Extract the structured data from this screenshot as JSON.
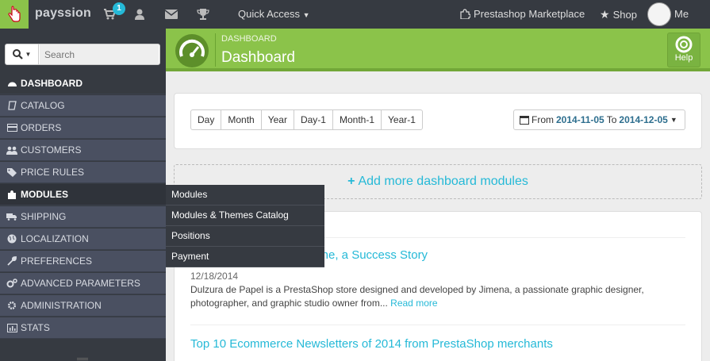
{
  "topbar": {
    "brand": "payssion",
    "cart_count": "1",
    "quick_access": "Quick Access",
    "marketplace": "Prestashop Marketplace",
    "shop": "Shop",
    "me": "Me"
  },
  "search": {
    "placeholder": "Search"
  },
  "sidebar": {
    "items": [
      {
        "label": "DASHBOARD",
        "icon": "dashboard-icon"
      },
      {
        "label": "CATALOG",
        "icon": "book-icon"
      },
      {
        "label": "ORDERS",
        "icon": "credit-card-icon"
      },
      {
        "label": "CUSTOMERS",
        "icon": "users-icon"
      },
      {
        "label": "PRICE RULES",
        "icon": "tags-icon"
      },
      {
        "label": "MODULES",
        "icon": "puzzle-icon"
      },
      {
        "label": "SHIPPING",
        "icon": "truck-icon"
      },
      {
        "label": "LOCALIZATION",
        "icon": "globe-icon"
      },
      {
        "label": "PREFERENCES",
        "icon": "wrench-icon"
      },
      {
        "label": "ADVANCED PARAMETERS",
        "icon": "cogs-icon"
      },
      {
        "label": "ADMINISTRATION",
        "icon": "cog-icon"
      },
      {
        "label": "STATS",
        "icon": "bar-chart-icon"
      }
    ]
  },
  "submenu": {
    "items": [
      "Modules",
      "Modules & Themes Catalog",
      "Positions",
      "Payment"
    ]
  },
  "header": {
    "breadcrumb": "DASHBOARD",
    "title": "Dashboard",
    "help": "Help"
  },
  "periods": [
    "Day",
    "Month",
    "Year",
    "Day-1",
    "Month-1",
    "Year-1"
  ],
  "date_range": {
    "from_label": "From",
    "from": "2014-11-05",
    "to_label": "To",
    "to": "2014-12-05"
  },
  "add_modules": "Add more dashboard modules",
  "news": [
    {
      "title": "Dulzura de Papel Online, a Success Story",
      "title_visible": "line, a Success Story",
      "date": "12/18/2014",
      "body": "Dulzura de Papel is a PrestaShop store designed and developed by Jimena, a passionate graphic designer, photographer, and graphic studio owner from...",
      "read_more": "Read more"
    },
    {
      "title": "Top 10 Ecommerce Newsletters of 2014 from PrestaShop merchants"
    }
  ],
  "colors": {
    "green": "#8bc34a",
    "sidebar": "#363a41",
    "accent": "#25b9d7"
  }
}
